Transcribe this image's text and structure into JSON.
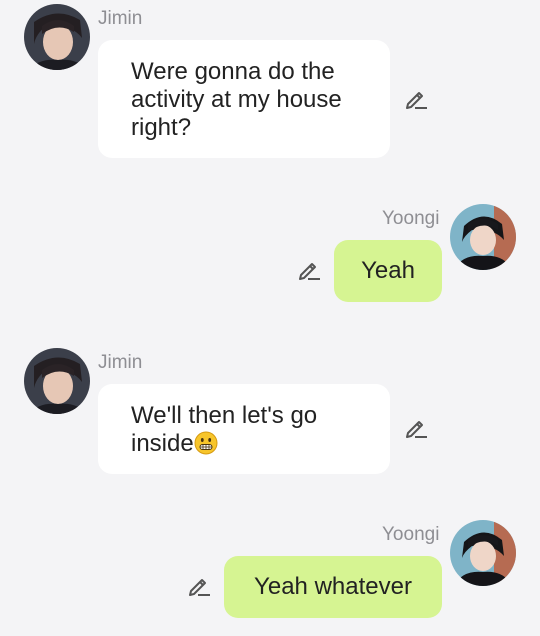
{
  "messages": [
    {
      "sender": "Jimin",
      "side": "incoming",
      "text": "Were gonna do the activity at my house right?"
    },
    {
      "sender": "Yoongi",
      "side": "outgoing",
      "text": "Yeah"
    },
    {
      "sender": "Jimin",
      "side": "incoming",
      "text": "We'll then let's go inside",
      "emoji": "grimacing-face-emoji"
    },
    {
      "sender": "Yoongi",
      "side": "outgoing",
      "text": "Yeah whatever"
    }
  ],
  "icons": {
    "edit": "pencil-edit-icon",
    "emoji": "grimacing-face-emoji"
  },
  "colors": {
    "background": "#f4f4f6",
    "incoming_bubble": "#ffffff",
    "outgoing_bubble": "#d6f492",
    "sender_name": "#8e8e93",
    "message_text": "#222222"
  }
}
